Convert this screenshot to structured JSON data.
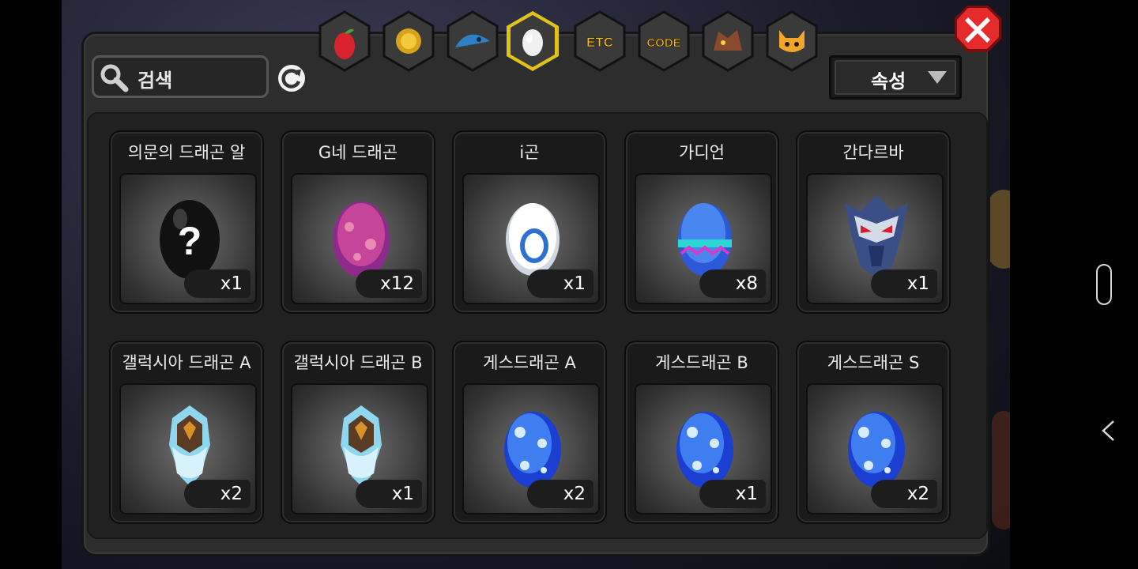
{
  "search": {
    "placeholder": "검색"
  },
  "sort": {
    "label": "속성"
  },
  "tabs": [
    {
      "name": "fruit",
      "label": ""
    },
    {
      "name": "gold",
      "label": ""
    },
    {
      "name": "fish",
      "label": ""
    },
    {
      "name": "egg",
      "label": "",
      "selected": true
    },
    {
      "name": "etc",
      "label": "ETC"
    },
    {
      "name": "code",
      "label": "CODE"
    },
    {
      "name": "dragon",
      "label": ""
    },
    {
      "name": "mask",
      "label": ""
    }
  ],
  "items": [
    {
      "name": "의문의 드래곤 알",
      "qty": "x1",
      "icon": "mystery-egg-icon"
    },
    {
      "name": "G네 드래곤",
      "qty": "x12",
      "icon": "pink-egg-icon"
    },
    {
      "name": "i곤",
      "qty": "x1",
      "icon": "white-egg-icon"
    },
    {
      "name": "가디언",
      "qty": "x8",
      "icon": "blue-pattern-egg-icon"
    },
    {
      "name": "간다르바",
      "qty": "x1",
      "icon": "armored-mask-icon"
    },
    {
      "name": "갤럭시아 드래곤 A",
      "qty": "x2",
      "icon": "galaxia-crest-icon"
    },
    {
      "name": "갤럭시아 드래곤 B",
      "qty": "x1",
      "icon": "galaxia-crest-icon"
    },
    {
      "name": "게스드래곤 A",
      "qty": "x2",
      "icon": "blue-spotted-egg-icon"
    },
    {
      "name": "게스드래곤 B",
      "qty": "x1",
      "icon": "blue-spotted-egg-icon"
    },
    {
      "name": "게스드래곤 S",
      "qty": "x2",
      "icon": "blue-spotted-egg-icon"
    }
  ]
}
